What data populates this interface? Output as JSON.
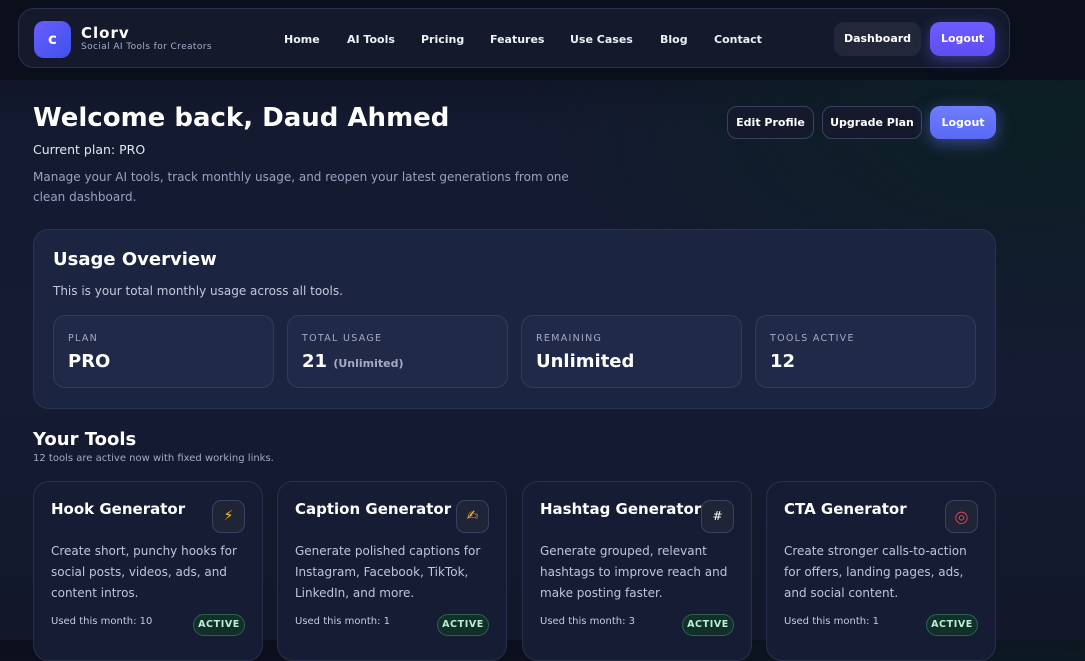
{
  "brand": {
    "logo_letter": "c",
    "name": "Clorv",
    "tagline": "Social AI Tools for Creators"
  },
  "nav": {
    "links": [
      "Home",
      "AI Tools",
      "Pricing",
      "Features",
      "Use Cases",
      "Blog",
      "Contact"
    ],
    "dashboard_label": "Dashboard",
    "logout_label": "Logout"
  },
  "welcome": {
    "title": "Welcome back, Daud Ahmed",
    "plan_line": "Current plan: PRO",
    "description": "Manage your AI tools, track monthly usage, and reopen your latest generations from one clean dashboard.",
    "edit_profile_label": "Edit Profile",
    "upgrade_label": "Upgrade Plan",
    "logout_label": "Logout"
  },
  "usage": {
    "title": "Usage Overview",
    "subtitle": "This is your total monthly usage across all tools.",
    "stats": [
      {
        "label": "PLAN",
        "value": "PRO",
        "note": ""
      },
      {
        "label": "TOTAL USAGE",
        "value": "21",
        "note": "(Unlimited)"
      },
      {
        "label": "REMAINING",
        "value": "Unlimited",
        "note": ""
      },
      {
        "label": "TOOLS ACTIVE",
        "value": "12",
        "note": ""
      }
    ]
  },
  "tools": {
    "title": "Your Tools",
    "subtitle": "12 tools are active now with fixed working links.",
    "cards": [
      {
        "title": "Hook Generator",
        "icon": "lightning-icon",
        "glyph": "⚡",
        "description": "Create short, punchy hooks for social posts, videos, ads, and content intros.",
        "used": "Used this month: 10",
        "status": "ACTIVE"
      },
      {
        "title": "Caption Generator",
        "icon": "writing-hand-icon",
        "glyph": "✍",
        "description": "Generate polished captions for Instagram, Facebook, TikTok, LinkedIn, and more.",
        "used": "Used this month: 1",
        "status": "ACTIVE"
      },
      {
        "title": "Hashtag Generator",
        "icon": "hashtag-icon",
        "glyph": "#",
        "description": "Generate grouped, relevant hashtags to improve reach and make posting faster.",
        "used": "Used this month: 3",
        "status": "ACTIVE"
      },
      {
        "title": "CTA Generator",
        "icon": "target-icon",
        "glyph": "◎",
        "description": "Create stronger calls-to-action for offers, landing pages, ads, and social content.",
        "used": "Used this month: 1",
        "status": "ACTIVE"
      }
    ]
  }
}
